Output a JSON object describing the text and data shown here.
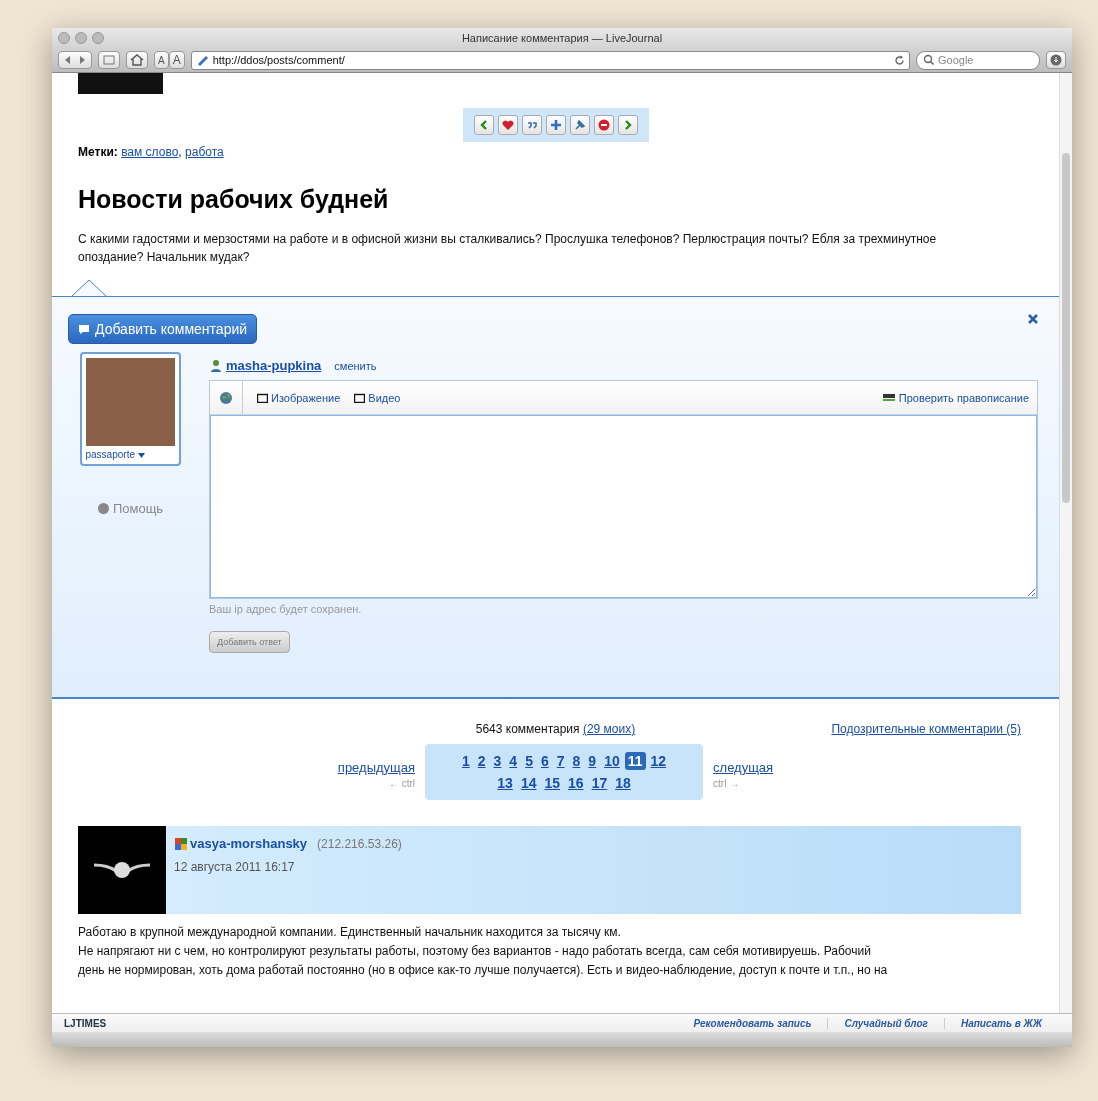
{
  "window": {
    "title": "Написание комментария — LiveJournal"
  },
  "toolbar": {
    "url": "http://ddos/posts/comment/",
    "text_sizes": [
      "A",
      "A"
    ],
    "search": {
      "placeholder": "Google"
    }
  },
  "tags": {
    "label": "Метки:",
    "separator": ",",
    "items": [
      "вам слово",
      "работа"
    ]
  },
  "post": {
    "title": "Новости рабочих будней",
    "body": "С какими гадостями и мерзостями на работе и в офисной жизни вы сталкивались? Прослушка телефонов? Перлюстрация почты? Ебля за трехминутное опоздание? Начальник мудак?"
  },
  "comment_form": {
    "header_button": "Добавить комментарий",
    "userpic_name": "passaporte",
    "help": "Помощь",
    "username": "masha-pupkina",
    "switch_link": "сменить",
    "tools": [
      "Изображение",
      "Видео"
    ],
    "spellcheck": "Проверить правописание",
    "ip_note": "Ваш ip адрес будет сохранен.",
    "submit": "Добавить ответ"
  },
  "comments_nav": {
    "count": "5643 комментария",
    "mine": "(29 моих)",
    "suspicious": "Подозрительные комментарии (5)",
    "prev": "предыдущая",
    "prev_hint": "← ctrl",
    "next": "следущая",
    "next_hint": "ctrl →",
    "pages": [
      {
        "label": "1",
        "selected": false
      },
      {
        "label": "2",
        "selected": false
      },
      {
        "label": "3",
        "selected": false
      },
      {
        "label": "4",
        "selected": false
      },
      {
        "label": "5",
        "selected": false
      },
      {
        "label": "6",
        "selected": false
      },
      {
        "label": "7",
        "selected": false
      },
      {
        "label": "8",
        "selected": false
      },
      {
        "label": "9",
        "selected": false
      },
      {
        "label": "10",
        "selected": false
      },
      {
        "label": "11",
        "selected": true
      },
      {
        "label": "12",
        "selected": false
      },
      {
        "label": "13",
        "selected": false
      },
      {
        "label": "14",
        "selected": false
      },
      {
        "label": "15",
        "selected": false
      },
      {
        "label": "16",
        "selected": false
      },
      {
        "label": "17",
        "selected": false
      },
      {
        "label": "18",
        "selected": false
      }
    ]
  },
  "comments": [
    {
      "username": "vasya-morshansky",
      "ip": "(212.216.53.26)",
      "date": "12 августа 2011 16:17",
      "lines": [
        "Работаю в крупной международной компании. Единственный начальник находится за тысячу км.",
        "Не напрягают ни с чем, но контролируют результаты работы, поэтому без вариантов - надо работать всегда, сам себя мотивируешь. Рабочий",
        "день не нормирован, хоть дома работай постоянно (но в офисе как-то лучше получается). Есть и видео-наблюдение, доступ к почте и т.п., но на"
      ]
    }
  ],
  "footer": {
    "brand": "LJTIMES",
    "links": [
      "Рекомендовать запись",
      "Случайный блог",
      "Написать в ЖЖ"
    ]
  }
}
